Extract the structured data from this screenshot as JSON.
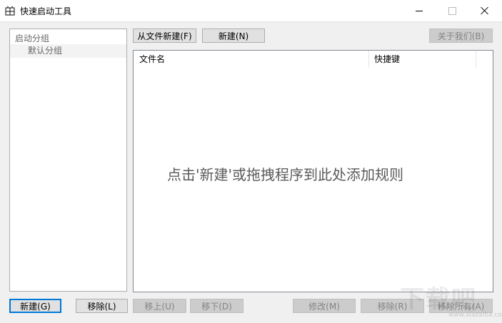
{
  "window": {
    "title": "快速启动工具",
    "icon": "grid-app-icon"
  },
  "sidebar": {
    "group_root": "启动分组",
    "groups": [
      "默认分组"
    ]
  },
  "toolbar": {
    "new_from_file": "从文件新建(F)",
    "new": "新建(N)",
    "about": "关于我们(B)"
  },
  "list": {
    "columns": [
      "文件名",
      "快捷键"
    ],
    "empty_hint": "点击'新建'或拖拽程序到此处添加规则"
  },
  "bottom_left": {
    "new": "新建(G)",
    "remove": "移除(L)",
    "move_up": "移上(U)",
    "move_down": "移下(D)"
  },
  "bottom_right": {
    "edit": "修改(M)",
    "remove": "移除(R)",
    "remove_all": "移除所有(A)"
  },
  "watermark": {
    "text": "下载吧",
    "url": "www.xiazaiba.com"
  }
}
